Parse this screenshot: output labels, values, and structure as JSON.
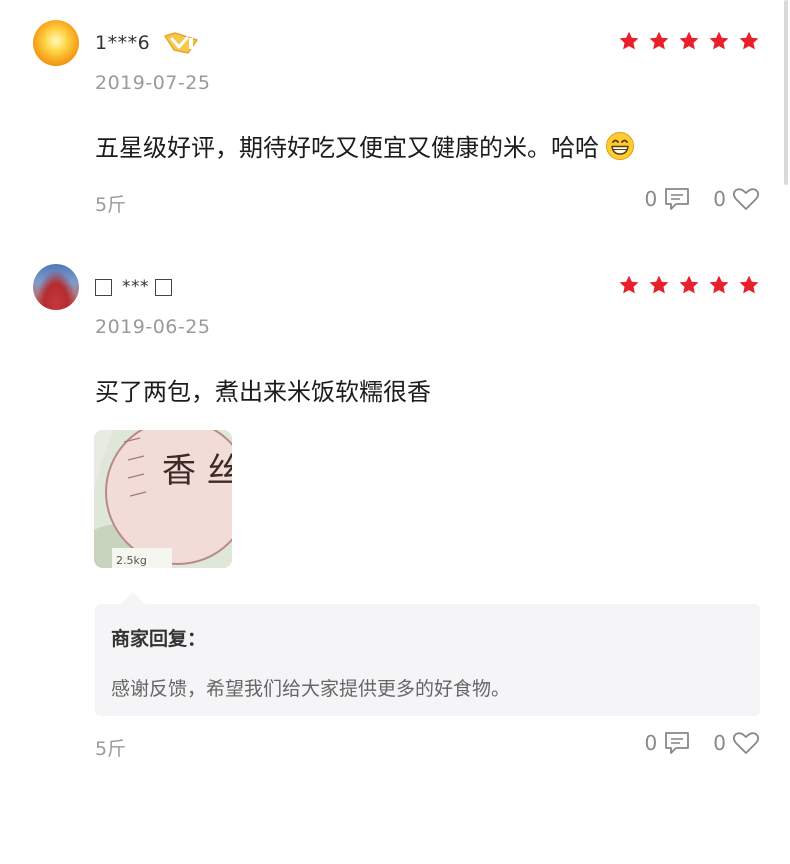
{
  "reviews": [
    {
      "user": {
        "name": "1***6",
        "badge_icon": "vip-badge-icon"
      },
      "rating": 5,
      "date": "2019-07-25",
      "content": "五星级好评，期待好吃又便宜又健康的米。哈哈",
      "emoji_icon": "grinning-face-icon",
      "spec": "5斤",
      "comments_count": "0",
      "likes_count": "0"
    },
    {
      "user": {
        "name": "***"
      },
      "rating": 5,
      "date": "2019-06-25",
      "content": "买了两包，煮出来米饭软糯很香",
      "photo_text": "香 丝",
      "photo_label": "2.5kg",
      "merchant_reply": {
        "title": "商家回复：",
        "text": "感谢反馈，希望我们给大家提供更多的好食物。"
      },
      "spec": "5斤",
      "comments_count": "0",
      "likes_count": "0"
    }
  ],
  "colors": {
    "star": "#e8202b",
    "badge": "#f0b93a",
    "muted": "#9a9a9a",
    "reply_bg": "#f5f5f7"
  }
}
